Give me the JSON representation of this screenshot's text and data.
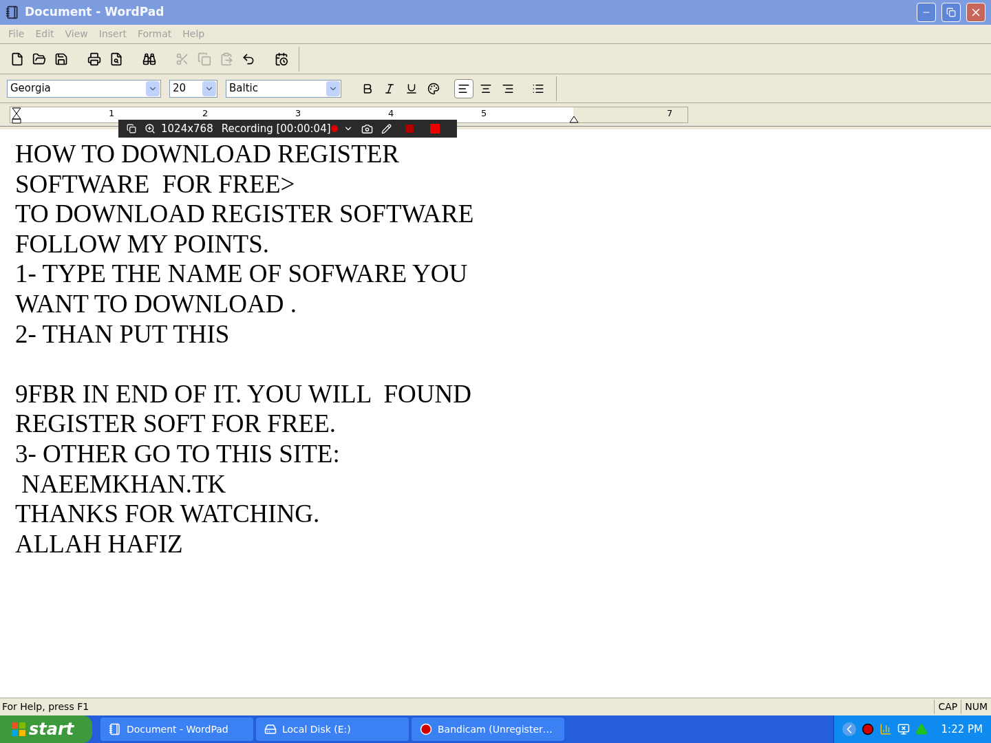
{
  "window": {
    "title": "Document - WordPad",
    "active": false
  },
  "menu": [
    "File",
    "Edit",
    "View",
    "Insert",
    "Format",
    "Help"
  ],
  "toolbar": [
    {
      "kind": "new",
      "disabled": false
    },
    {
      "kind": "open",
      "disabled": false
    },
    {
      "kind": "save",
      "disabled": false
    },
    {
      "kind": "sep"
    },
    {
      "kind": "print",
      "disabled": false
    },
    {
      "kind": "preview",
      "disabled": false
    },
    {
      "kind": "sep"
    },
    {
      "kind": "find",
      "disabled": false
    },
    {
      "kind": "sep"
    },
    {
      "kind": "cut",
      "disabled": true
    },
    {
      "kind": "copy",
      "disabled": true
    },
    {
      "kind": "paste",
      "disabled": true
    },
    {
      "kind": "undo",
      "disabled": false
    },
    {
      "kind": "sep"
    },
    {
      "kind": "datetime",
      "disabled": false
    }
  ],
  "format_bar": {
    "font": "Georgia",
    "size": "20",
    "script": "Baltic",
    "buttons": [
      {
        "kind": "bold",
        "selected": false
      },
      {
        "kind": "italic",
        "selected": false
      },
      {
        "kind": "underline",
        "selected": false
      },
      {
        "kind": "color",
        "selected": false
      },
      {
        "kind": "sep"
      },
      {
        "kind": "left",
        "selected": true
      },
      {
        "kind": "center",
        "selected": false
      },
      {
        "kind": "right",
        "selected": false
      },
      {
        "kind": "sep"
      },
      {
        "kind": "bullets",
        "selected": false
      }
    ]
  },
  "ruler": {
    "numbers": [
      "1",
      "2",
      "3",
      "4",
      "5",
      "7"
    ]
  },
  "recorder": {
    "resolution": "1024x768",
    "status": "Recording [00:00:04]"
  },
  "document": {
    "blocks": [
      [
        "HOW TO DOWNLOAD REGISTER",
        "SOFTWARE  FOR FREE>",
        "TO DOWNLOAD REGISTER SOFTWARE",
        "FOLLOW MY POINTS.",
        "1- TYPE THE NAME OF SOFWARE YOU",
        "WANT TO DOWNLOAD .",
        "2- THAN PUT THIS"
      ],
      [
        "9FBR IN END OF IT. YOU WILL  FOUND",
        "REGISTER SOFT FOR FREE.",
        "3- OTHER GO TO THIS SITE:",
        " NAEEMKHAN.TK",
        "THANKS FOR WATCHING.",
        "ALLAH HAFIZ"
      ]
    ]
  },
  "status_bar": {
    "help": "For Help, press F1",
    "indicators": [
      "CAP",
      "NUM"
    ]
  },
  "taskbar": {
    "start": "start",
    "tasks": [
      {
        "label": "Document - WordPad",
        "kind": "wordpad",
        "selected": false
      },
      {
        "label": "Local Disk (E:)",
        "kind": "disk",
        "selected": false
      },
      {
        "label": "Bandicam (Unregister…",
        "kind": "record",
        "selected": false
      }
    ],
    "clock": "1:22 PM"
  }
}
